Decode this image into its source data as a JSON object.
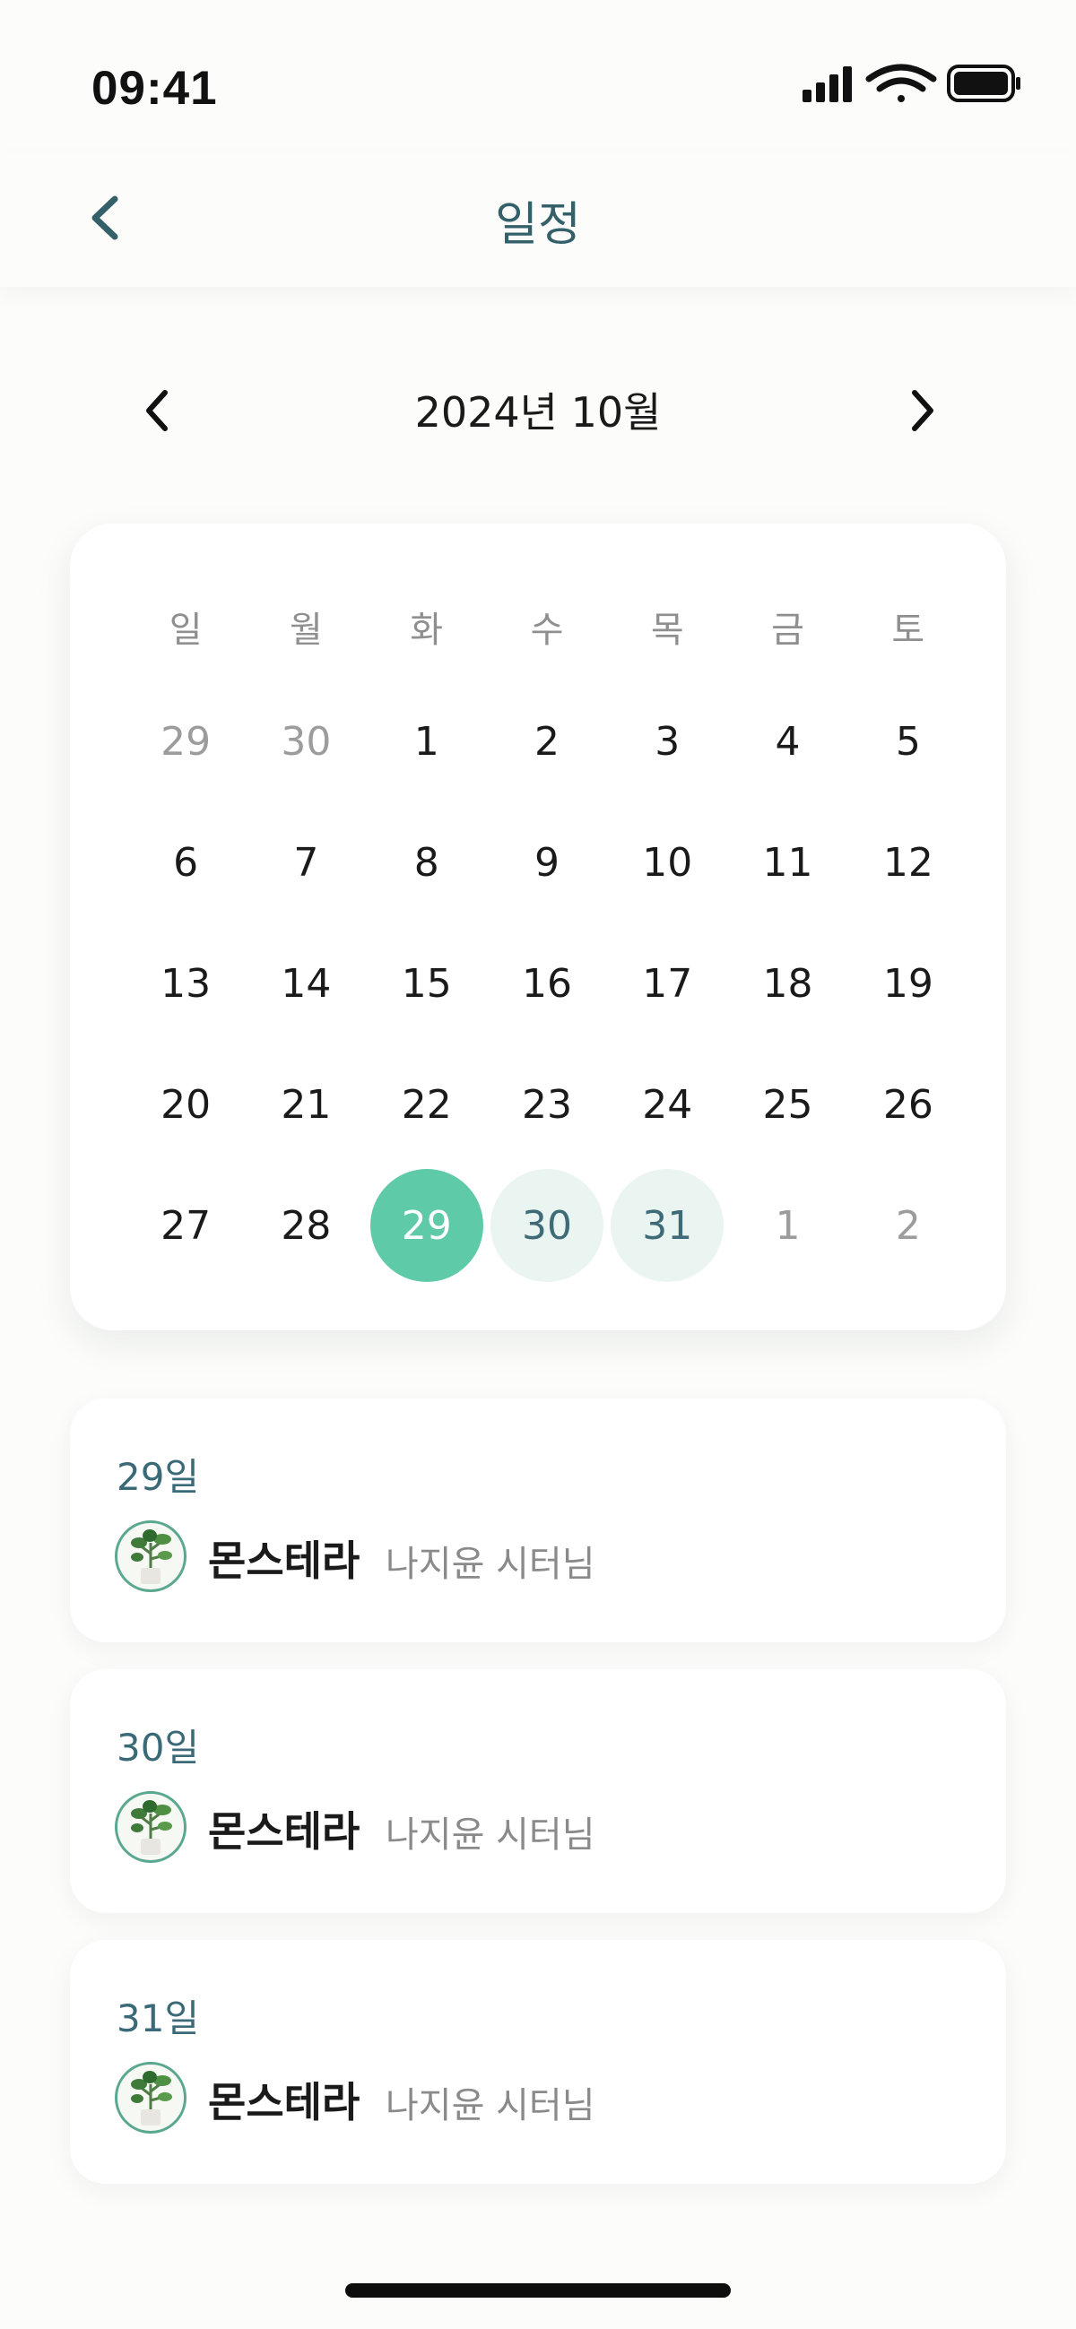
{
  "status_bar": {
    "time": "09:41",
    "icons": [
      "signal-icon",
      "wifi-icon",
      "battery-icon"
    ]
  },
  "nav": {
    "title": "일정",
    "back_icon": "chevron-left-icon"
  },
  "calendar": {
    "month_label": "2024년 10월",
    "prev_icon": "chevron-left-icon",
    "next_icon": "chevron-right-icon",
    "weekdays": [
      "일",
      "월",
      "화",
      "수",
      "목",
      "금",
      "토"
    ],
    "weeks": [
      [
        {
          "d": "29",
          "s": "muted"
        },
        {
          "d": "30",
          "s": "muted"
        },
        {
          "d": "1",
          "s": ""
        },
        {
          "d": "2",
          "s": ""
        },
        {
          "d": "3",
          "s": ""
        },
        {
          "d": "4",
          "s": ""
        },
        {
          "d": "5",
          "s": ""
        }
      ],
      [
        {
          "d": "6",
          "s": ""
        },
        {
          "d": "7",
          "s": ""
        },
        {
          "d": "8",
          "s": ""
        },
        {
          "d": "9",
          "s": ""
        },
        {
          "d": "10",
          "s": ""
        },
        {
          "d": "11",
          "s": ""
        },
        {
          "d": "12",
          "s": ""
        }
      ],
      [
        {
          "d": "13",
          "s": ""
        },
        {
          "d": "14",
          "s": ""
        },
        {
          "d": "15",
          "s": ""
        },
        {
          "d": "16",
          "s": ""
        },
        {
          "d": "17",
          "s": ""
        },
        {
          "d": "18",
          "s": ""
        },
        {
          "d": "19",
          "s": ""
        }
      ],
      [
        {
          "d": "20",
          "s": ""
        },
        {
          "d": "21",
          "s": ""
        },
        {
          "d": "22",
          "s": ""
        },
        {
          "d": "23",
          "s": ""
        },
        {
          "d": "24",
          "s": ""
        },
        {
          "d": "25",
          "s": ""
        },
        {
          "d": "26",
          "s": ""
        }
      ],
      [
        {
          "d": "27",
          "s": ""
        },
        {
          "d": "28",
          "s": ""
        },
        {
          "d": "29",
          "s": "selected"
        },
        {
          "d": "30",
          "s": "range"
        },
        {
          "d": "31",
          "s": "range"
        },
        {
          "d": "1",
          "s": "muted"
        },
        {
          "d": "2",
          "s": "muted"
        }
      ]
    ],
    "colors": {
      "selected": "#5ecaa7",
      "range": "#eaf4f1",
      "muted": "#9c9c9c"
    }
  },
  "schedules": [
    {
      "date": "29일",
      "plant": "몬스테라",
      "sitter": "나지윤 시터님",
      "avatar_icon": "plant-avatar-icon"
    },
    {
      "date": "30일",
      "plant": "몬스테라",
      "sitter": "나지윤 시터님",
      "avatar_icon": "plant-avatar-icon"
    },
    {
      "date": "31일",
      "plant": "몬스테라",
      "sitter": "나지윤 시터님",
      "avatar_icon": "plant-avatar-icon"
    }
  ]
}
